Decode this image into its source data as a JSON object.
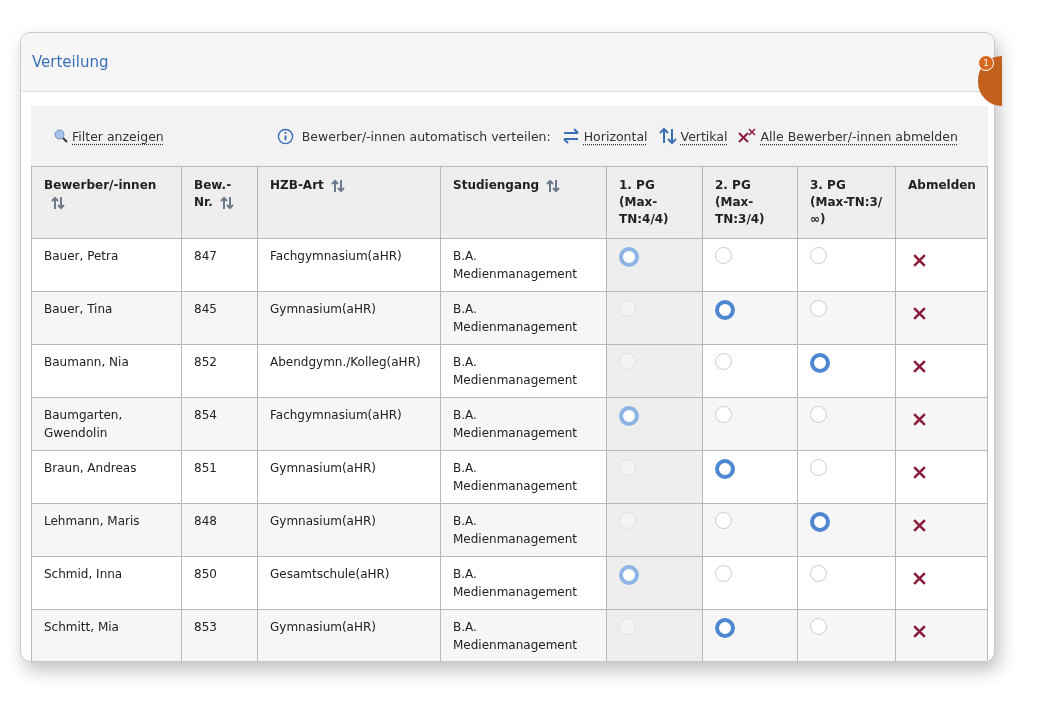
{
  "panel": {
    "title": "Verteilung"
  },
  "notification": {
    "badge": "1"
  },
  "toolbar": {
    "filter": "Filter anzeigen",
    "auto_label": "Bewerber/-innen automatisch verteilen:",
    "horizontal": "Horizontal",
    "vertical": "Vertikal",
    "unregister_all": "Alle Bewerber/-innen abmelden"
  },
  "table": {
    "columns": [
      {
        "label": "Bewerber/-innen",
        "sortable": true
      },
      {
        "label": "Bew.-Nr.",
        "sortable": true
      },
      {
        "label": "HZB-Art",
        "sortable": true
      },
      {
        "label": "Studiengang",
        "sortable": true
      },
      {
        "label": "1. PG (Max-TN:4/4)",
        "sortable": false,
        "disabled": true
      },
      {
        "label": "2. PG (Max-TN:3/4)",
        "sortable": false,
        "disabled": false
      },
      {
        "label": "3. PG (Max-TN:3/∞)",
        "sortable": false,
        "disabled": false
      },
      {
        "label": "Abmelden",
        "sortable": false
      }
    ],
    "rows": [
      {
        "name": "Bauer, Petra",
        "nr": "847",
        "hzb": "Fachgymnasium(aHR)",
        "studiengang": "B.A. Medienmanagement",
        "choices": [
          {
            "selected": true
          },
          {
            "selected": false
          },
          {
            "selected": false
          }
        ]
      },
      {
        "name": "Bauer, Tina",
        "nr": "845",
        "hzb": "Gymnasium(aHR)",
        "studiengang": "B.A. Medienmanagement",
        "choices": [
          {
            "selected": false
          },
          {
            "selected": true
          },
          {
            "selected": false
          }
        ]
      },
      {
        "name": "Baumann, Nia",
        "nr": "852",
        "hzb": "Abendgymn./Kolleg(aHR)",
        "studiengang": "B.A. Medienmanagement",
        "choices": [
          {
            "selected": false
          },
          {
            "selected": false
          },
          {
            "selected": true
          }
        ]
      },
      {
        "name": "Baumgarten, Gwendolin",
        "nr": "854",
        "hzb": "Fachgymnasium(aHR)",
        "studiengang": "B.A. Medienmanagement",
        "choices": [
          {
            "selected": true
          },
          {
            "selected": false
          },
          {
            "selected": false
          }
        ]
      },
      {
        "name": "Braun, Andreas",
        "nr": "851",
        "hzb": "Gymnasium(aHR)",
        "studiengang": "B.A. Medienmanagement",
        "choices": [
          {
            "selected": false
          },
          {
            "selected": true
          },
          {
            "selected": false
          }
        ]
      },
      {
        "name": "Lehmann, Maris",
        "nr": "848",
        "hzb": "Gymnasium(aHR)",
        "studiengang": "B.A. Medienmanagement",
        "choices": [
          {
            "selected": false
          },
          {
            "selected": false
          },
          {
            "selected": true
          }
        ]
      },
      {
        "name": "Schmid, Inna",
        "nr": "850",
        "hzb": "Gesamtschule(aHR)",
        "studiengang": "B.A. Medienmanagement",
        "choices": [
          {
            "selected": true
          },
          {
            "selected": false
          },
          {
            "selected": false
          }
        ]
      },
      {
        "name": "Schmitt, Mia",
        "nr": "853",
        "hzb": "Gymnasium(aHR)",
        "studiengang": "B.A. Medienmanagement",
        "choices": [
          {
            "selected": false
          },
          {
            "selected": true
          },
          {
            "selected": false
          }
        ]
      }
    ]
  }
}
